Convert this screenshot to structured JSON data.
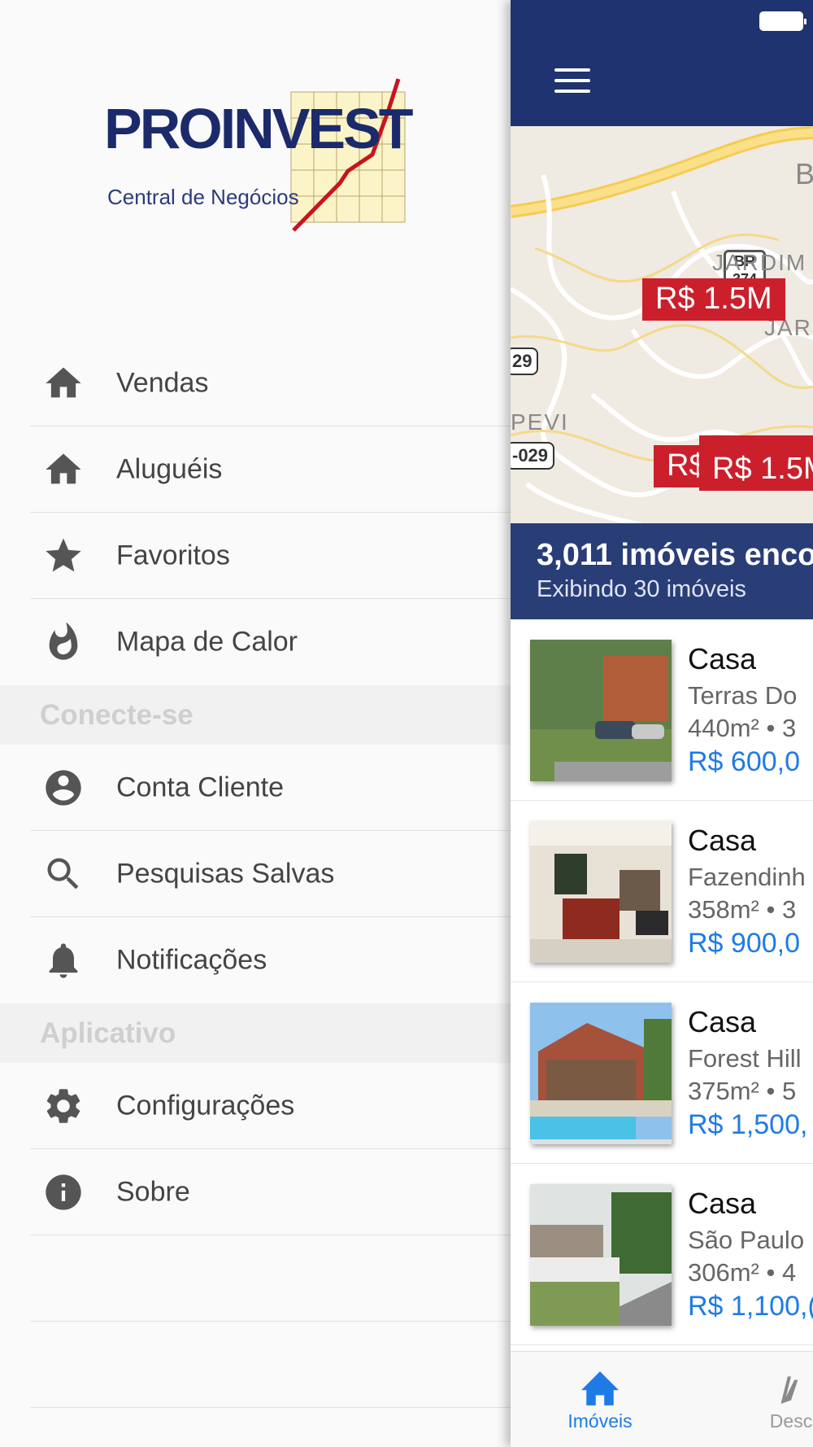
{
  "brand": {
    "name": "PROINVEST",
    "tagline": "Central de Negócios"
  },
  "drawer": {
    "items_main": [
      {
        "label": "Vendas",
        "icon": "home-icon"
      },
      {
        "label": "Aluguéis",
        "icon": "home-icon"
      },
      {
        "label": "Favoritos",
        "icon": "star-icon"
      },
      {
        "label": "Mapa de Calor",
        "icon": "flame-icon"
      }
    ],
    "section_connect": "Conecte-se",
    "items_connect": [
      {
        "label": "Conta Cliente",
        "icon": "account-circle-icon"
      },
      {
        "label": "Pesquisas Salvas",
        "icon": "search-icon"
      },
      {
        "label": "Notificações",
        "icon": "bell-icon"
      }
    ],
    "section_app": "Aplicativo",
    "items_app": [
      {
        "label": "Configurações",
        "icon": "gear-icon"
      },
      {
        "label": "Sobre",
        "icon": "info-icon"
      }
    ]
  },
  "map": {
    "labels": [
      "JARDIM A",
      "JARD",
      "PEVI",
      "B"
    ],
    "road_shields": [
      "BR 374",
      "29",
      "-029"
    ],
    "markers": [
      "R$ 1.5M",
      "R$",
      "R$ 1.5M"
    ]
  },
  "results": {
    "count": "3,011 imóveis enco",
    "shown": "Exibindo 30 imóveis"
  },
  "listings": [
    {
      "type": "Casa",
      "location": "Terras Do",
      "area": "440m² • 3",
      "price": "R$ 600,0"
    },
    {
      "type": "Casa",
      "location": "Fazendinh",
      "area": "358m² • 3",
      "price": "R$ 900,0"
    },
    {
      "type": "Casa",
      "location": "Forest Hill",
      "area": "375m² • 5",
      "price": "R$ 1,500,"
    },
    {
      "type": "Casa",
      "location": "São Paulo",
      "area": "306m² • 4",
      "price": "R$ 1,100,("
    }
  ],
  "tabbar": {
    "tabs": [
      {
        "label": "Imóveis",
        "icon": "home-icon",
        "active": true
      },
      {
        "label": "Desc",
        "icon": "hand-icon",
        "active": false
      }
    ]
  },
  "colors": {
    "navbar": "#1e3370",
    "accent_blue": "#1e7be6",
    "marker_red": "#cc1f2c",
    "drawer_bg": "#fafafa",
    "section_bg": "#f1f1f1"
  }
}
